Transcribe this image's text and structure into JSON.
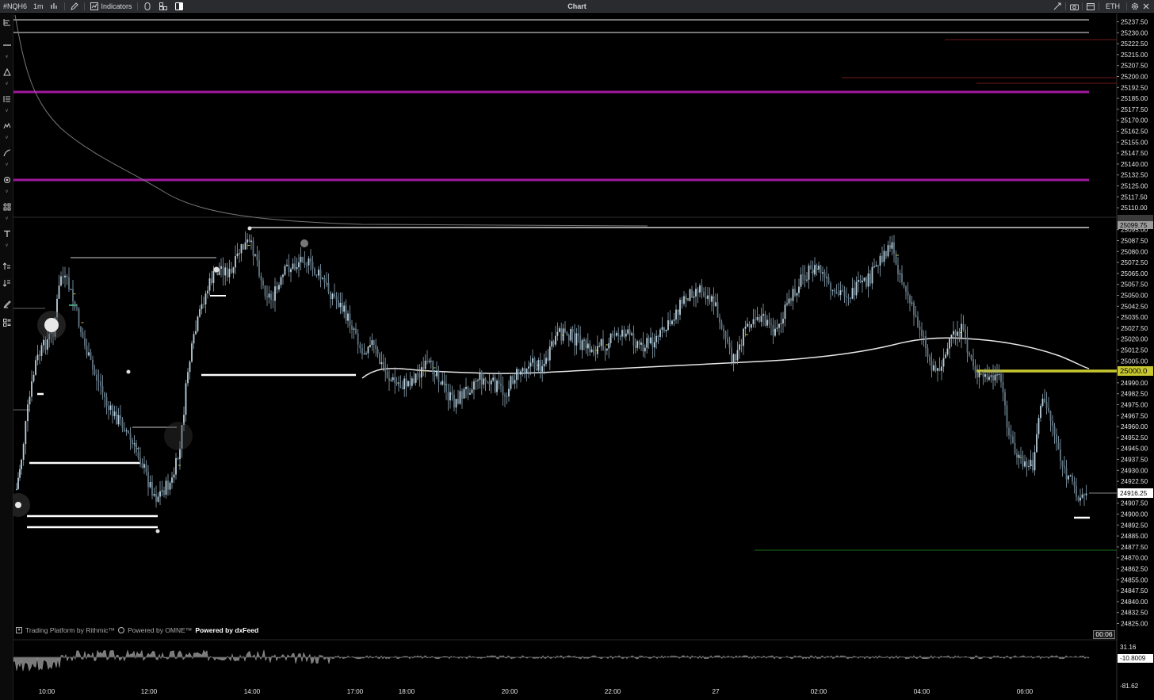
{
  "toolbar": {
    "symbol": "#NQH6",
    "timeframe": "1m",
    "indicators_label": "Indicators",
    "title": "Chart",
    "session": "ETH",
    "icons": [
      "chart-type-icon",
      "pencil-icon",
      "indicators-icon",
      "clock-icon",
      "layout-icon",
      "panel-toggle-icon",
      "crosshair-icon",
      "camera-icon",
      "calendar-icon",
      "settings-icon",
      "close-icon"
    ]
  },
  "left_toolbar": {
    "tools": [
      "cursor-tool-icon",
      "horizontal-line-icon",
      "triangle-icon",
      "fib-icon",
      "pattern-icon",
      "curve-icon",
      "magnet-icon",
      "shapes-icon",
      "text-icon",
      "long-position-icon",
      "short-position-icon",
      "brush-icon",
      "layers-icon"
    ]
  },
  "price_axis": {
    "labels": [
      "25237.50",
      "25230.00",
      "25222.50",
      "25215.00",
      "25207.50",
      "25200.00",
      "25192.50",
      "25185.00",
      "25177.50",
      "25170.00",
      "25162.50",
      "25155.00",
      "25147.50",
      "25140.00",
      "25132.50",
      "25125.00",
      "25117.50",
      "25110.00",
      "25095.00",
      "25087.50",
      "25080.00",
      "25072.50",
      "25065.00",
      "25057.50",
      "25050.00",
      "25042.50",
      "25035.00",
      "25027.50",
      "25020.00",
      "25012.50",
      "25005.00",
      "24990.00",
      "24982.50",
      "24975.00",
      "24967.50",
      "24960.00",
      "24952.50",
      "24945.00",
      "24937.50",
      "24930.00",
      "24922.50",
      "24907.50",
      "24900.00",
      "24892.50",
      "24885.00",
      "24877.50",
      "24870.00",
      "24862.50",
      "24855.00",
      "24847.50",
      "24840.00",
      "24832.50",
      "24825.00"
    ],
    "high_marker": "25099.75",
    "yellow_marker": "25000.0",
    "last_price": "24916.25"
  },
  "time_axis": {
    "labels": [
      "10:00",
      "12:00",
      "14:00",
      "17:00",
      "18:00",
      "20:00",
      "22:00",
      "27",
      "02:00",
      "04:00",
      "06:00"
    ]
  },
  "indicator_panel": {
    "labels": [
      "31.16",
      "-10.8009",
      "-81.62"
    ]
  },
  "credits": {
    "rithmic": "Trading Platform by Rithmic™",
    "omne": "Powered by OMNE™",
    "dxfeed": "Powered by dxFeed"
  },
  "bar_timer": "00:06",
  "colors": {
    "background": "#000000",
    "magenta_level": "#a0199e",
    "yellow_level": "#c8c832",
    "candle": "#9db4c4",
    "vwap": "#e6e6e6"
  }
}
